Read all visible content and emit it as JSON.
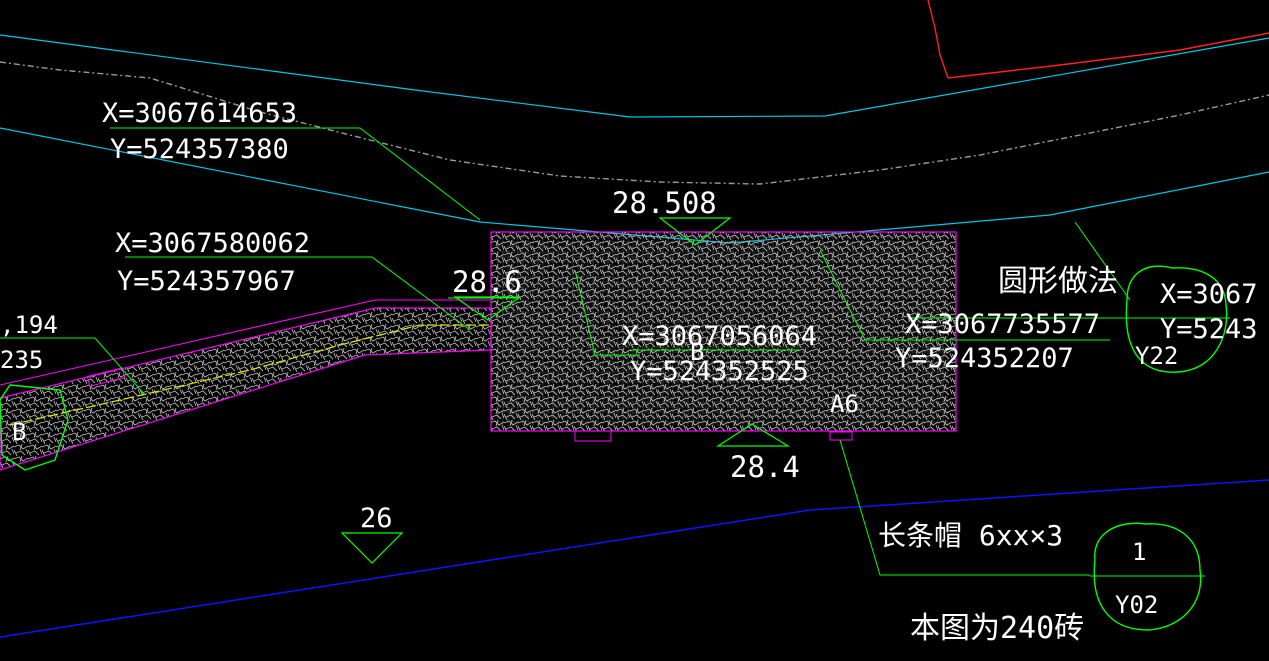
{
  "annotations": {
    "coord_top_left_x": "X=3067614653",
    "coord_top_left_y": "Y=524357380",
    "coord_mid_left_x": "X=3067580062",
    "coord_mid_left_y": "Y=524357967",
    "coord_far_left_top": ",194",
    "coord_far_left_bottom": "235",
    "coord_center_x": "X=3067056064",
    "coord_center_y": "Y=524352525",
    "coord_right_x": "X=3067735577",
    "coord_right_y": "Y=524352207",
    "coord_far_right_x": "X=3067",
    "coord_far_right_y": "Y=5243",
    "elev_top": "28.508",
    "elev_left": "28.6",
    "elev_bottom": "28.4",
    "elev_lower": "26",
    "label_center_tag": "B",
    "label_right_tag": "A6",
    "label_method": "圆形做法",
    "label_strip_cap": "长条帽 6xx×3",
    "label_note": "本图为240砖",
    "label_left_marker": "B"
  },
  "callouts": [
    {
      "id": "callout-right",
      "top": "",
      "bottom": "Y22"
    },
    {
      "id": "callout-lower",
      "top": "1",
      "bottom": "Y02"
    }
  ],
  "colors": {
    "background": "#000000",
    "leader": "#00ff00",
    "boundary_cyan": "#00c8e6",
    "road_blue": "#0a14ff",
    "magenta": "#ff00ff",
    "red": "#ff2020",
    "hatch": "#c8c8c8",
    "centerline": "#e6e600",
    "text": "#ffffff"
  }
}
